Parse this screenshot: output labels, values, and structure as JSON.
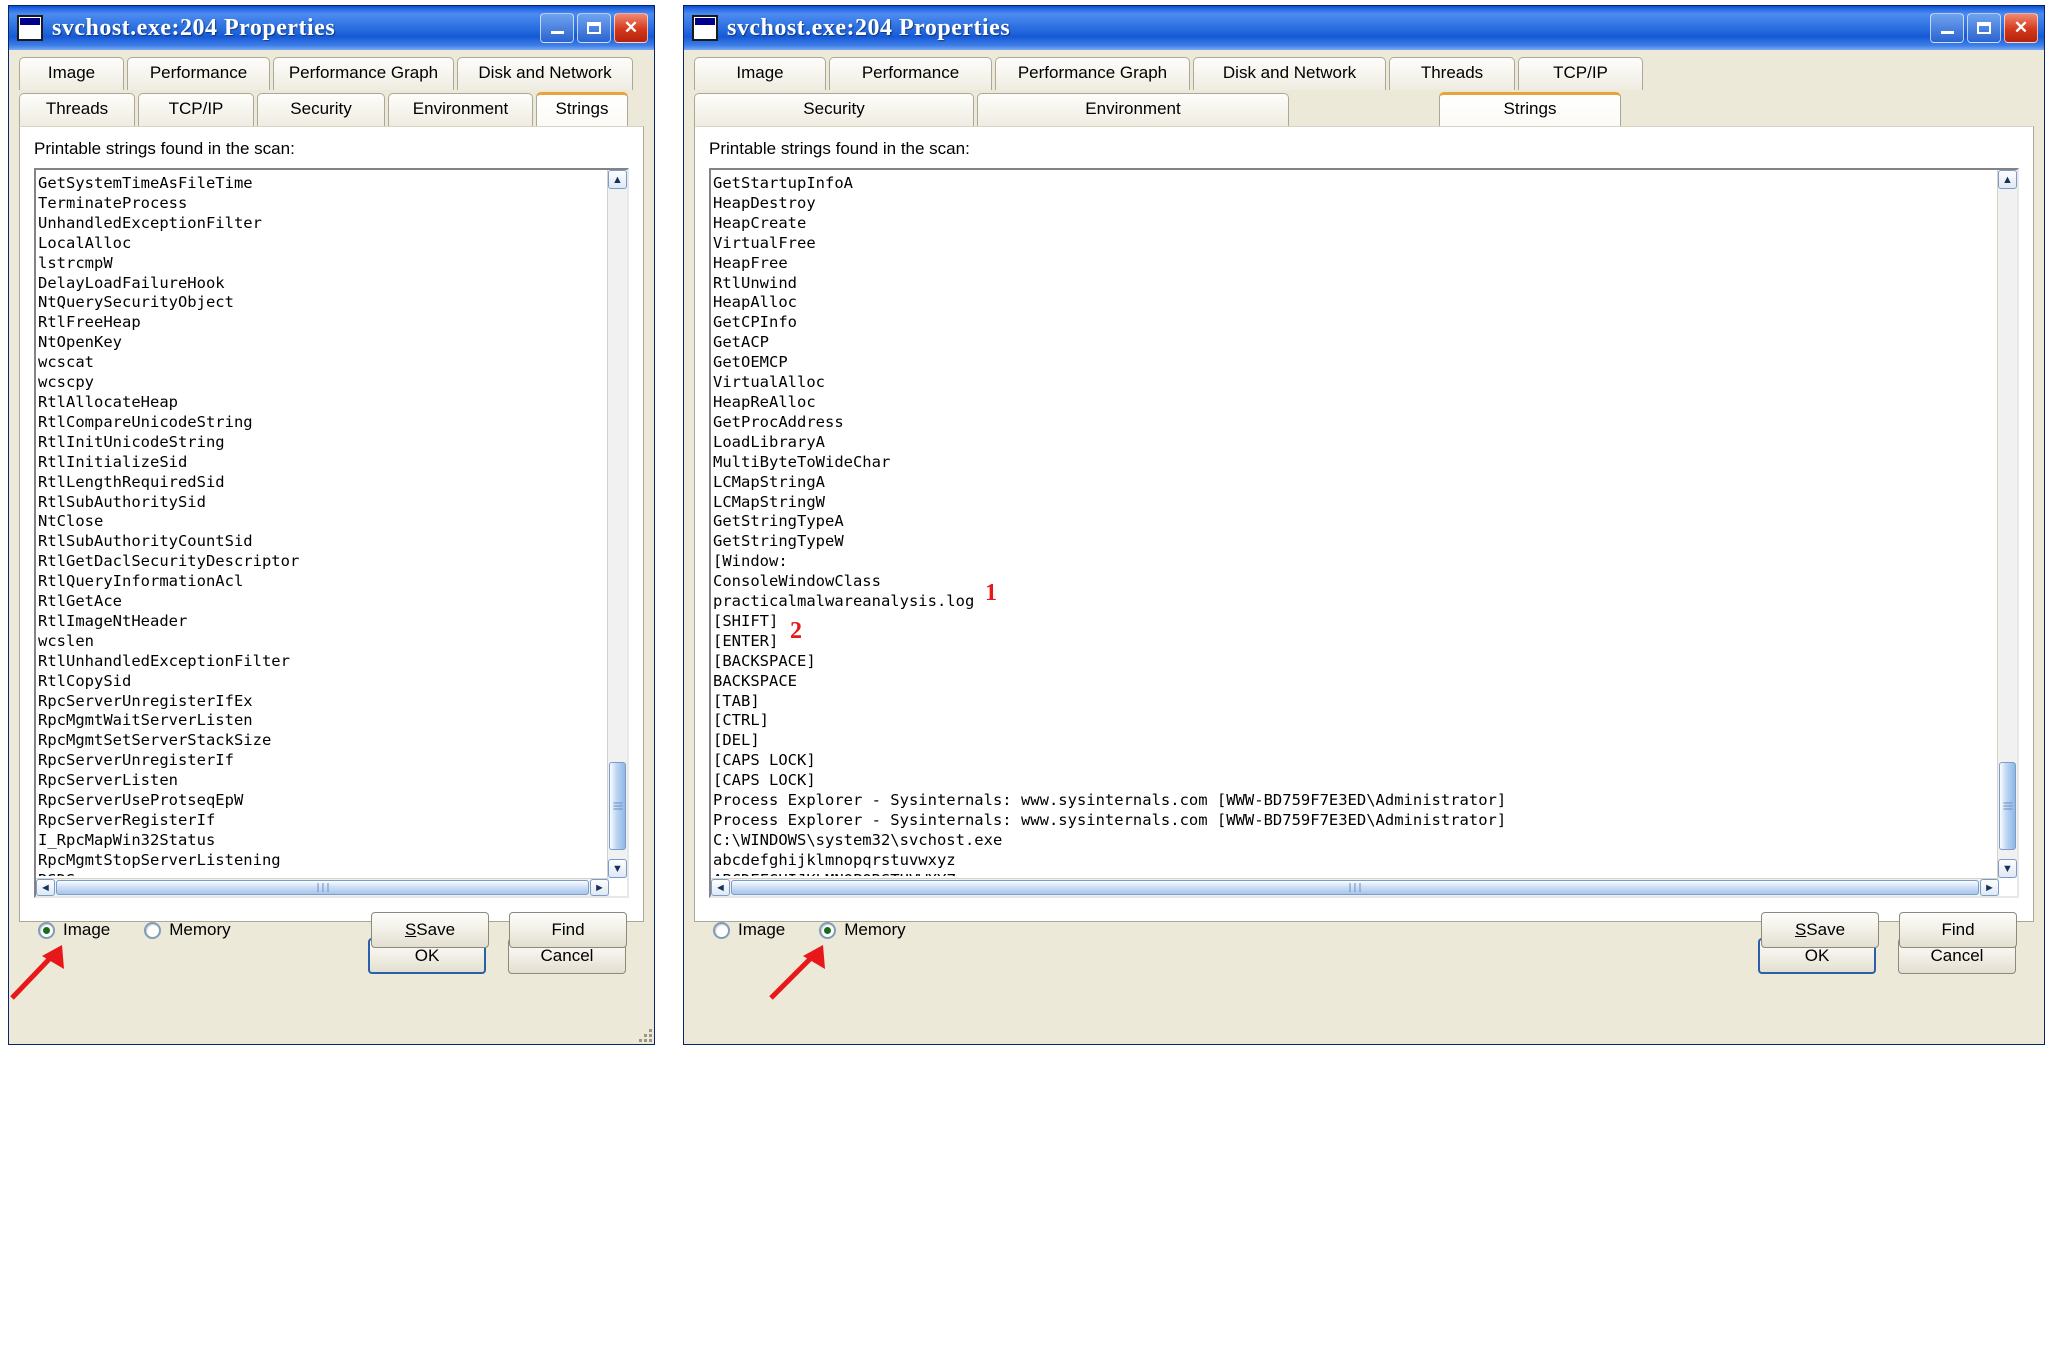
{
  "windows": [
    {
      "id": "left",
      "title": "svchost.exe:204 Properties",
      "icon": "window-document-icon",
      "titlebar_buttons": {
        "minimize": "_",
        "maximize": "□",
        "close": "✕"
      },
      "tabs_row1": [
        "Image",
        "Performance",
        "Performance Graph",
        "Disk and Network"
      ],
      "tabs_row2": [
        "Threads",
        "TCP/IP",
        "Security",
        "Environment",
        "Strings"
      ],
      "selected_tab": "Strings",
      "panel_label": "Printable strings found in the scan:",
      "strings": [
        "GetSystemTimeAsFileTime",
        "TerminateProcess",
        "UnhandledExceptionFilter",
        "LocalAlloc",
        "lstrcmpW",
        "DelayLoadFailureHook",
        "NtQuerySecurityObject",
        "RtlFreeHeap",
        "NtOpenKey",
        "wcscat",
        "wcscpy",
        "RtlAllocateHeap",
        "RtlCompareUnicodeString",
        "RtlInitUnicodeString",
        "RtlInitializeSid",
        "RtlLengthRequiredSid",
        "RtlSubAuthoritySid",
        "NtClose",
        "RtlSubAuthorityCountSid",
        "RtlGetDaclSecurityDescriptor",
        "RtlQueryInformationAcl",
        "RtlGetAce",
        "RtlImageNtHeader",
        "wcslen",
        "RtlUnhandledExceptionFilter",
        "RtlCopySid",
        "RpcServerUnregisterIfEx",
        "RpcMgmtWaitServerListen",
        "RpcMgmtSetServerStackSize",
        "RpcServerUnregisterIf",
        "RpcServerListen",
        "RpcServerUseProtseqEpW",
        "RpcServerRegisterIf",
        "I_RpcMapWin32Status",
        "RpcMgmtStopServerListening",
        "RSDS"
      ],
      "source_options": [
        {
          "label": "Image",
          "selected": true
        },
        {
          "label": "Memory",
          "selected": false
        }
      ],
      "buttons": {
        "save": "Save",
        "find": "Find",
        "ok": "OK",
        "cancel": "Cancel"
      },
      "annotation_arrow": "red-arrow-pointing-to-image-radio"
    },
    {
      "id": "right",
      "title": "svchost.exe:204 Properties",
      "icon": "window-document-icon",
      "titlebar_buttons": {
        "minimize": "_",
        "maximize": "□",
        "close": "✕"
      },
      "tabs_row1": [
        "Image",
        "Performance",
        "Performance Graph",
        "Disk and Network",
        "Threads",
        "TCP/IP"
      ],
      "tabs_row2": [
        "Security",
        "Environment",
        "Strings"
      ],
      "selected_tab": "Strings",
      "panel_label": "Printable strings found in the scan:",
      "strings": [
        "GetStartupInfoA",
        "HeapDestroy",
        "HeapCreate",
        "VirtualFree",
        "HeapFree",
        "RtlUnwind",
        "HeapAlloc",
        "GetCPInfo",
        "GetACP",
        "GetOEMCP",
        "VirtualAlloc",
        "HeapReAlloc",
        "GetProcAddress",
        "LoadLibraryA",
        "MultiByteToWideChar",
        "LCMapStringA",
        "LCMapStringW",
        "GetStringTypeA",
        "GetStringTypeW",
        "[Window:",
        "ConsoleWindowClass",
        "practicalmalwareanalysis.log",
        "[SHIFT]",
        "[ENTER]",
        "[BACKSPACE]",
        "BACKSPACE",
        "[TAB]",
        "[CTRL]",
        "[DEL]",
        "[CAPS LOCK]",
        "[CAPS LOCK]",
        "Process Explorer - Sysinternals: www.sysinternals.com [WWW-BD759F7E3ED\\Administrator]",
        "Process Explorer - Sysinternals: www.sysinternals.com [WWW-BD759F7E3ED\\Administrator]",
        "C:\\WINDOWS\\system32\\svchost.exe",
        "abcdefghijklmnopqrstuvwxyz",
        "ABCDEFGHIJKLMNOPQRSTUVWXYZ"
      ],
      "source_options": [
        {
          "label": "Image",
          "selected": false
        },
        {
          "label": "Memory",
          "selected": true
        }
      ],
      "buttons": {
        "save": "Save",
        "find": "Find",
        "ok": "OK",
        "cancel": "Cancel"
      },
      "annotation_arrow": "red-arrow-pointing-to-memory-radio",
      "annotations": [
        {
          "mark": "1",
          "target_line": "practicalmalwareanalysis.log"
        },
        {
          "mark": "2",
          "target_line": "[ENTER]"
        }
      ]
    }
  ],
  "colors": {
    "titlebar_blue": "#2f74e3",
    "dialog_face": "#ece9d8",
    "selected_tab_accent": "#e8a33d",
    "annotation_red": "#e8171a",
    "radio_dot_green": "#1a6b1a"
  }
}
